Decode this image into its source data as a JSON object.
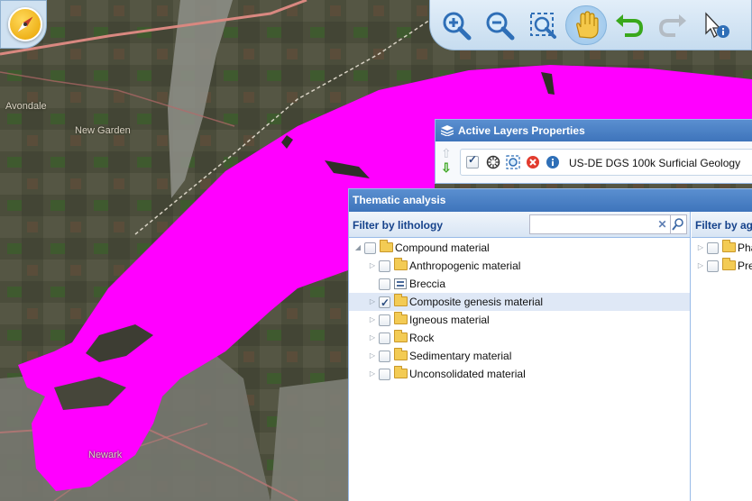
{
  "map": {
    "places": [
      "Avondale",
      "New Garden",
      "Newark"
    ],
    "overlay_color": "#ff00ff"
  },
  "toolbar": {
    "buttons": [
      {
        "name": "zoom-in",
        "icon": "zoom-in-icon"
      },
      {
        "name": "zoom-out",
        "icon": "zoom-out-icon"
      },
      {
        "name": "zoom-extent",
        "icon": "zoom-extent-icon"
      },
      {
        "name": "pan",
        "icon": "hand-icon",
        "active": true
      },
      {
        "name": "undo",
        "icon": "undo-icon"
      },
      {
        "name": "redo",
        "icon": "redo-icon"
      },
      {
        "name": "identify",
        "icon": "identify-cursor-icon"
      }
    ]
  },
  "active_layers": {
    "title": "Active Layers Properties",
    "layer": {
      "name": "US-DE DGS 100k Surficial Geology",
      "visible": true
    }
  },
  "thematic": {
    "title": "Thematic analysis",
    "lithology": {
      "header": "Filter by lithology",
      "filter_value": "",
      "tree": [
        {
          "label": "Compound material",
          "level": 0,
          "expanded": true,
          "checked": false,
          "kind": "folder"
        },
        {
          "label": "Anthropogenic material",
          "level": 1,
          "expandable": true,
          "checked": false,
          "kind": "folder"
        },
        {
          "label": "Breccia",
          "level": 1,
          "expandable": false,
          "checked": false,
          "kind": "leaf"
        },
        {
          "label": "Composite genesis material",
          "level": 1,
          "expandable": true,
          "checked": true,
          "kind": "folder",
          "selected": true
        },
        {
          "label": "Igneous material",
          "level": 1,
          "expandable": true,
          "checked": false,
          "kind": "folder"
        },
        {
          "label": "Rock",
          "level": 1,
          "expandable": true,
          "checked": false,
          "kind": "folder"
        },
        {
          "label": "Sedimentary material",
          "level": 1,
          "expandable": true,
          "checked": false,
          "kind": "folder"
        },
        {
          "label": "Unconsolidated material",
          "level": 1,
          "expandable": true,
          "checked": false,
          "kind": "folder"
        }
      ]
    },
    "age": {
      "header": "Filter by ag",
      "tree": [
        {
          "label": "Pha",
          "checked": false
        },
        {
          "label": "Pre",
          "checked": false
        }
      ]
    }
  }
}
